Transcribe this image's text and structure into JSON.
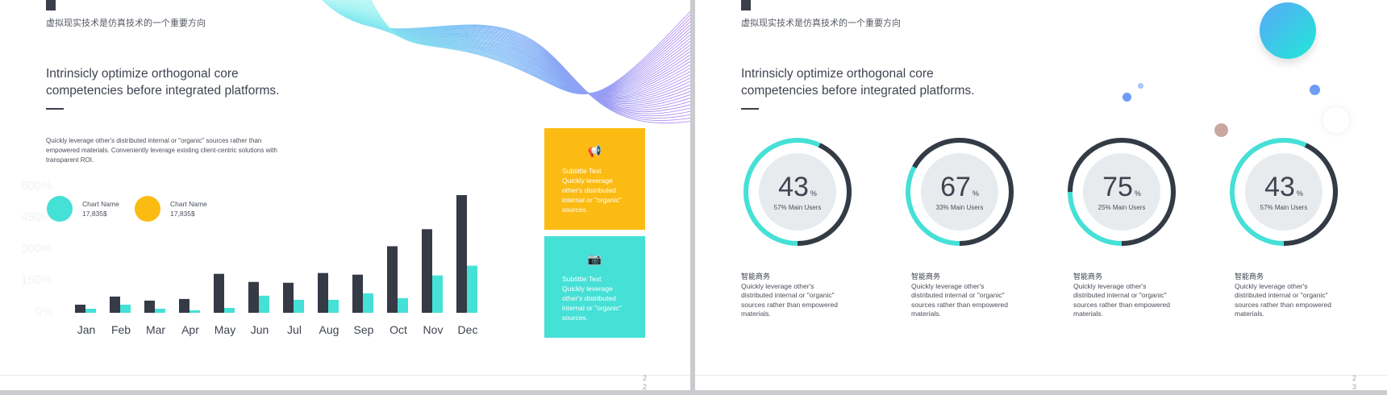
{
  "left_slide": {
    "subtitle": "虚拟现实技术是仿真技术的一个重要方向",
    "heading_line1": "Intrinsicly optimize orthogonal core",
    "heading_line2": "competencies before integrated platforms.",
    "paragraph": "Quickly leverage other's distributed internal or \"organic\" sources rather than empowered materials. Conveniently leverage existing client-centric solutions with transparent ROI.",
    "legend": [
      {
        "name": "Chart Name",
        "value": "17,835$",
        "color": "#45e0d6"
      },
      {
        "name": "Chart Name",
        "value": "17,835$",
        "color": "#fbbb12"
      }
    ],
    "watermark_ticks": [
      "600%",
      "450%",
      "300%",
      "150%",
      "0%"
    ],
    "cards": [
      {
        "icon": "megaphone-icon",
        "glyph": "📢",
        "title": "Subtittle Text",
        "text": "Quickly leverage other's distributed internal or \"organic\" sources.",
        "color": "#fbbb12"
      },
      {
        "icon": "camera-icon",
        "glyph": "📷",
        "title": "Subtittle Text",
        "text": "Quickly leverage other's distributed internal or \"organic\" sources.",
        "color": "#45e0d6"
      }
    ],
    "page_number_line1": "2",
    "page_number_line2": "2"
  },
  "chart_data": {
    "type": "bar",
    "categories": [
      "Jan",
      "Feb",
      "Mar",
      "Apr",
      "May",
      "Jun",
      "Jul",
      "Aug",
      "Sep",
      "Oct",
      "Nov",
      "Dec"
    ],
    "series": [
      {
        "values": [
          10,
          20,
          15,
          17,
          48,
          38,
          37,
          49,
          47,
          82,
          103,
          145
        ],
        "color": "#353a45"
      },
      {
        "values": [
          5,
          10,
          5,
          3,
          6,
          21,
          16,
          16,
          24,
          18,
          46,
          58
        ],
        "color": "#45e0d6"
      }
    ],
    "ylim": [
      0,
      150
    ]
  },
  "right_slide": {
    "subtitle": "虚拟现实技术是仿真技术的一个重要方向",
    "heading_line1": "Intrinsicly optimize orthogonal core",
    "heading_line2": "competencies before integrated platforms.",
    "gauges": [
      {
        "value": "43",
        "percent": 43,
        "unit": "%",
        "label": "57% Main Users"
      },
      {
        "value": "67",
        "percent": 67,
        "unit": "%",
        "label": "33% Main Users"
      },
      {
        "value": "75",
        "percent": 75,
        "unit": "%",
        "label": "25% Main Users"
      },
      {
        "value": "43",
        "percent": 43,
        "unit": "%",
        "label": "57% Main Users"
      }
    ],
    "stats": [
      {
        "title": "智能商务",
        "text": "Quickly leverage other's distributed internal or \"organic\" sources rather than empowered materials."
      },
      {
        "title": "智能商务",
        "text": "Quickly leverage other's distributed internal or \"organic\" sources rather than empowered materials."
      },
      {
        "title": "智能商务",
        "text": "Quickly leverage other's distributed internal or \"organic\" sources rather than empowered materials."
      },
      {
        "title": "智能商务",
        "text": "Quickly leverage other's distributed internal or \"organic\" sources rather than empowered materials."
      }
    ],
    "page_number_line1": "2",
    "page_number_line2": "3"
  },
  "colors": {
    "dark": "#353a45",
    "teal": "#45e0d6",
    "yellow": "#fbbb12",
    "gauge_inner": "#e8ebee"
  }
}
